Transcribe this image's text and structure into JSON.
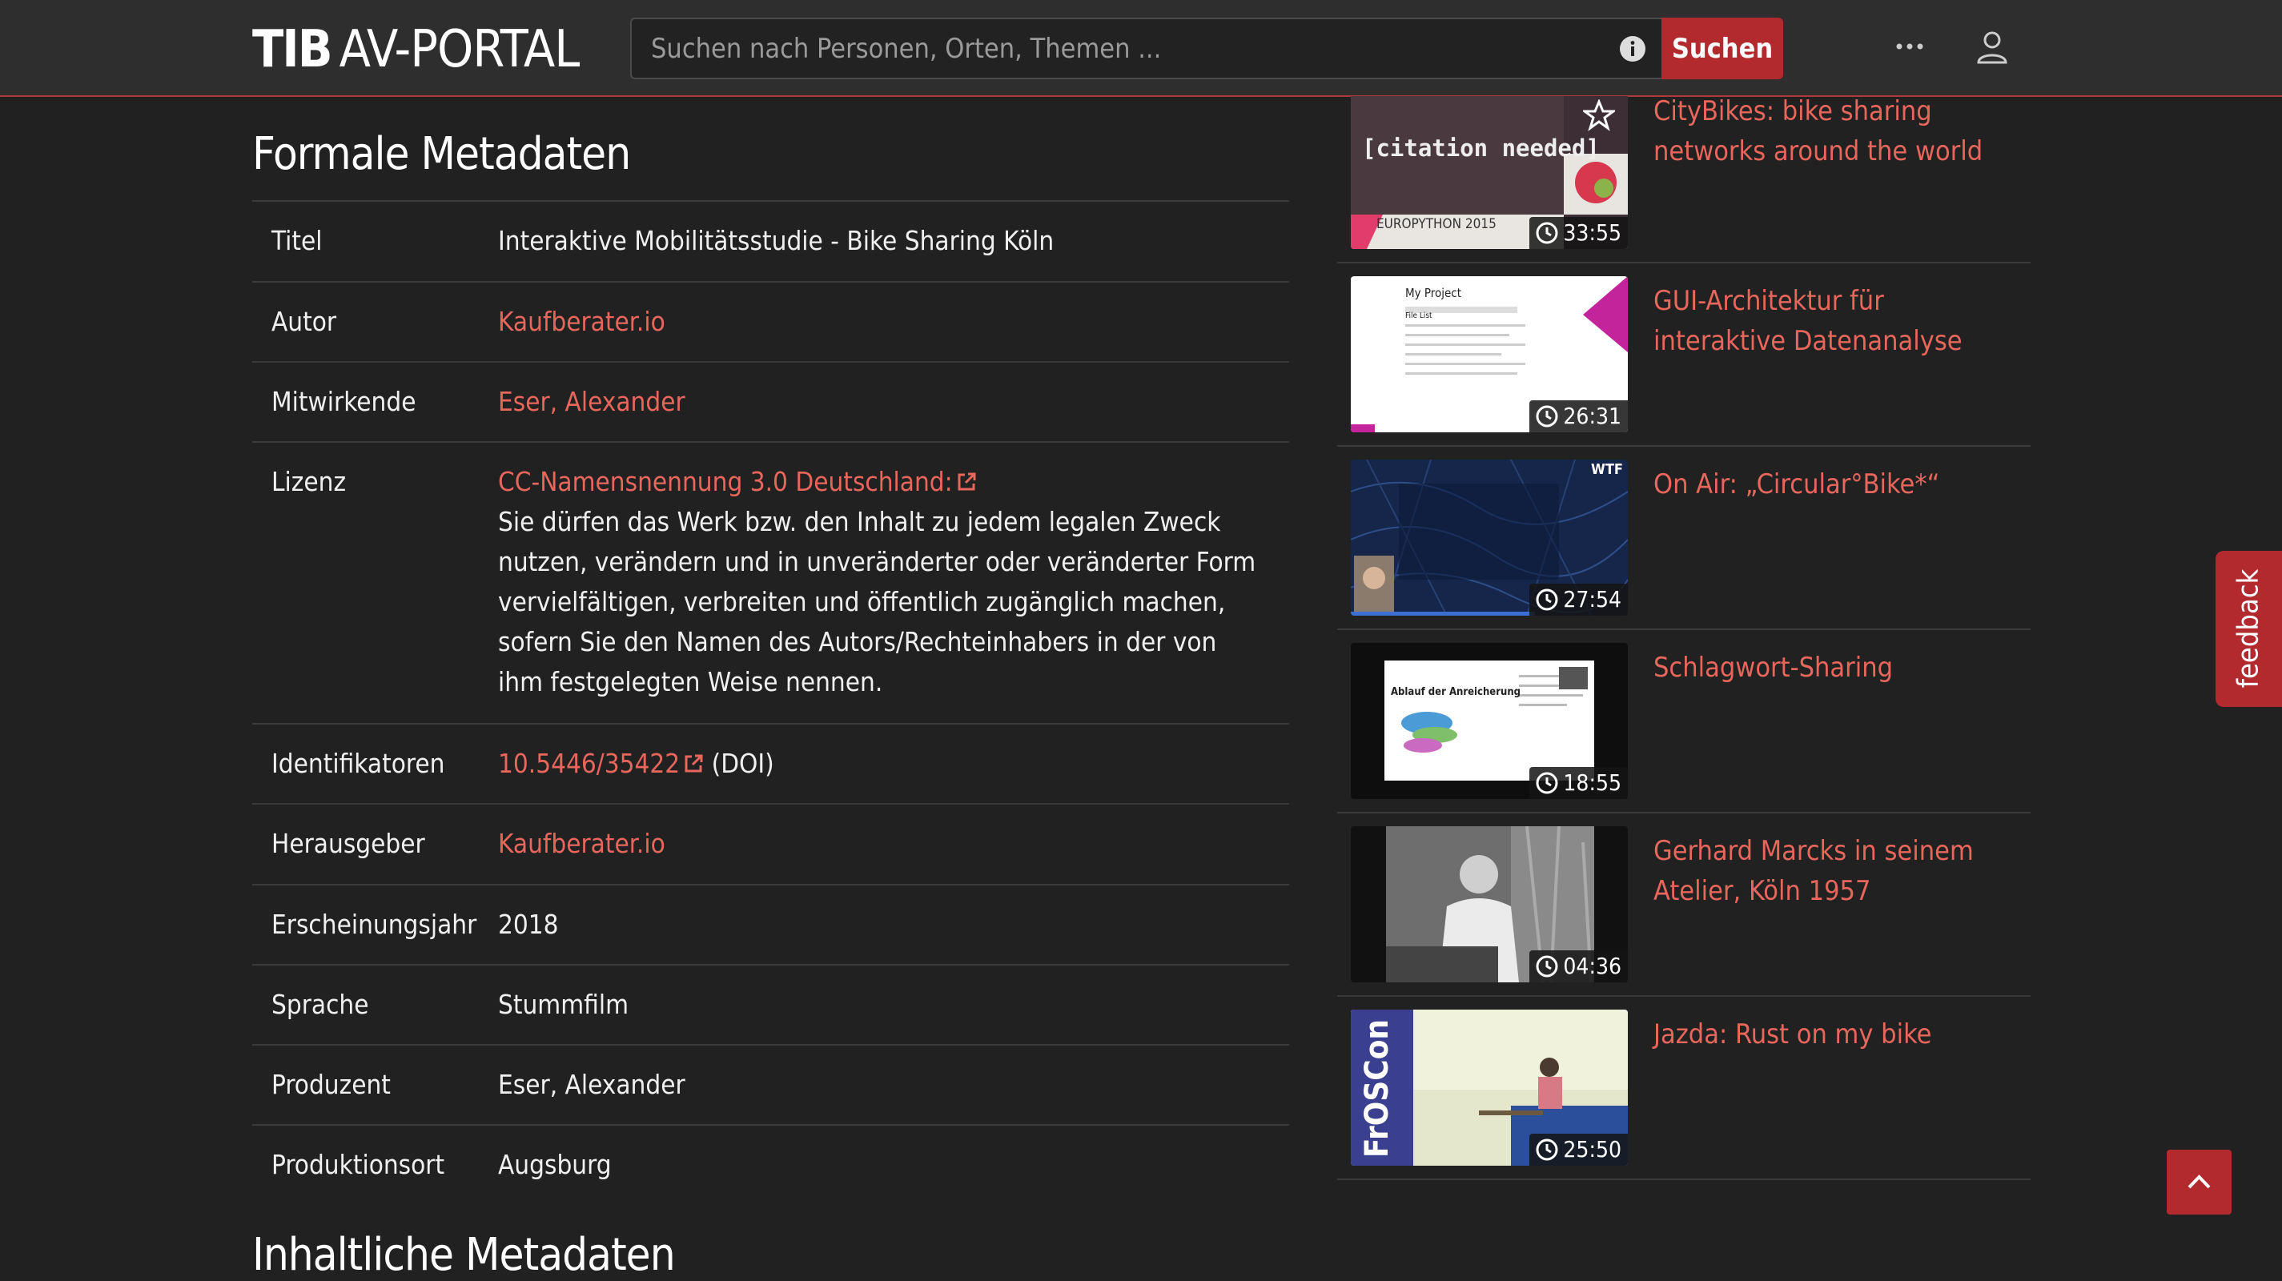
{
  "logo": {
    "tib": "TIB",
    "rest": "AV-PORTAL"
  },
  "search": {
    "placeholder": "Suchen nach Personen, Orten, Themen ...",
    "button_label": "Suchen"
  },
  "colors": {
    "accent": "#b2292e",
    "link": "#e8665c",
    "background": "#212121",
    "navbar": "#2e2e2e"
  },
  "formal": {
    "title": "Formale Metadaten",
    "rows": [
      {
        "label": "Titel",
        "value": "Interaktive Mobilitätsstudie - Bike Sharing Köln"
      },
      {
        "label": "Autor",
        "value": "Kaufberater.io"
      },
      {
        "label": "Mitwirkende",
        "value": "Eser, Alexander"
      },
      {
        "label": "Lizenz",
        "link": "CC-Namensnennung 3.0 Deutschland:",
        "value": "Sie dürfen das Werk bzw. den Inhalt zu jedem legalen Zweck nutzen, verändern und in unveränderter oder veränderter Form vervielfältigen, verbreiten und öffentlich zugänglich machen, sofern Sie den Namen des Autors/Rechteinhabers in der von ihm festgelegten Weise nennen."
      },
      {
        "label": "Identifikatoren",
        "link": "10.5446/35422",
        "value": "(DOI)"
      },
      {
        "label": "Herausgeber",
        "value": "Kaufberater.io"
      },
      {
        "label": "Erscheinungsjahr",
        "value": "2018"
      },
      {
        "label": "Sprache",
        "value": "Stummfilm"
      },
      {
        "label": "Produzent",
        "value": "Eser, Alexander"
      },
      {
        "label": "Produktionsort",
        "value": "Augsburg"
      }
    ]
  },
  "content_section_title": "Inhaltliche Metadaten",
  "related": [
    {
      "title": "CityBikes: bike sharing networks around the world",
      "duration": "33:55",
      "thumb_text": "[citation needed]",
      "thumb_caption": "EUROPYTHON 2015"
    },
    {
      "title": "GUI-Architektur für interaktive Datenanalyse",
      "duration": "26:31",
      "thumb_text": "My Project",
      "thumb_caption": "File List"
    },
    {
      "title": "On Air: „Circular°Bike*“",
      "duration": "27:54",
      "thumb_text": "WTF"
    },
    {
      "title": "Schlagwort-Sharing",
      "duration": "18:55",
      "thumb_text": "Ablauf der Anreicherung"
    },
    {
      "title": "Gerhard Marcks in seinem Atelier, Köln 1957",
      "duration": "04:36"
    },
    {
      "title": "Jazda: Rust on my bike",
      "duration": "25:50",
      "thumb_text": "FrOSCon"
    }
  ],
  "feedback_label": "feedback"
}
